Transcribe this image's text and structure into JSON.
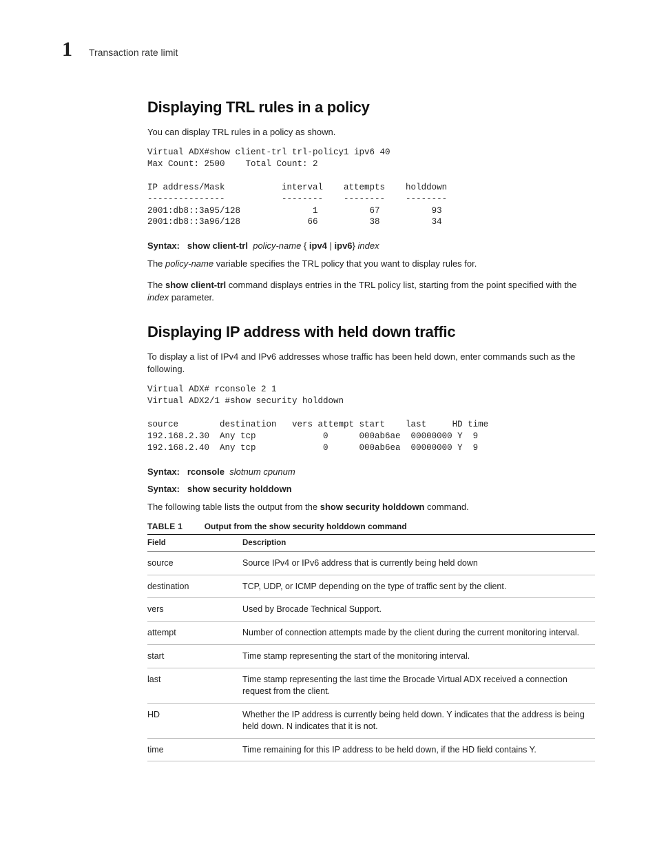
{
  "header": {
    "chapter_num": "1",
    "chapter_title": "Transaction rate limit"
  },
  "section1": {
    "title": "Displaying TRL rules in a policy",
    "intro": "You can display TRL rules in a policy as shown.",
    "code": "Virtual ADX#show client-trl trl-policy1 ipv6 40\nMax Count: 2500    Total Count: 2\n\nIP address/Mask           interval    attempts    holddown\n---------------           --------    --------    --------\n2001:db8::3a95/128              1          67          93\n2001:db8::3a96/128             66          38          34",
    "syntax_label": "Syntax:",
    "syntax_cmd": "show client-trl",
    "syntax_arg1": "policy-name",
    "syntax_brace_open": " { ",
    "syntax_opt1": "ipv4",
    "syntax_pipe": " | ",
    "syntax_opt2": "ipv6",
    "syntax_brace_close": "} ",
    "syntax_arg2": "index",
    "p1_a": "The ",
    "p1_b": "policy-name",
    "p1_c": " variable specifies the TRL policy that you want to display rules for.",
    "p2_a": "The ",
    "p2_b": "show client-trl",
    "p2_c": " command displays entries in the TRL policy list, starting from the point specified with the ",
    "p2_d": "index",
    "p2_e": " parameter."
  },
  "section2": {
    "title": "Displaying IP address with held down traffic",
    "intro": "To display a list of IPv4 and IPv6 addresses whose traffic has been held down, enter commands such as the following.",
    "code": "Virtual ADX# rconsole 2 1\nVirtual ADX2/1 #show security holddown\n\nsource        destination   vers attempt start    last     HD time\n192.168.2.30  Any tcp             0      000ab6ae  00000000 Y  9\n192.168.2.40  Any tcp             0      000ab6ea  00000000 Y  9",
    "syntax1_label": "Syntax:",
    "syntax1_cmd": "rconsole",
    "syntax1_args": "slotnum cpunum",
    "syntax2_label": "Syntax:",
    "syntax2_cmd": "show security holddown",
    "p1_a": "The following table lists the output from the ",
    "p1_b": "show security holddown",
    "p1_c": " command.",
    "table_label": "TABLE 1",
    "table_title": "Output from the show security holddown command",
    "th1": "Field",
    "th2": "Description",
    "rows": [
      {
        "field": "source",
        "desc_a": "Source IPv4 or IPv6 address that is currently being held down",
        "desc_b": "",
        "desc_c": ""
      },
      {
        "field": "destination",
        "desc_a": "TCP, UDP, or ICMP depending on the type of traffic sent by the client.",
        "desc_b": "",
        "desc_c": ""
      },
      {
        "field": "vers",
        "desc_a": "Used by Brocade Technical Support.",
        "desc_b": "",
        "desc_c": ""
      },
      {
        "field": "attempt",
        "desc_a": "Number of connection attempts made by the client during the current monitoring interval.",
        "desc_b": "",
        "desc_c": ""
      },
      {
        "field": "start",
        "desc_a": "Time stamp representing the start of the monitoring interval.",
        "desc_b": "",
        "desc_c": ""
      },
      {
        "field": "last",
        "desc_a": "Time stamp representing the last time the ",
        "desc_b": "Brocade Virtual ADX",
        "desc_c": " received a connection request from the client."
      },
      {
        "field": "HD",
        "desc_a": "Whether the IP address is currently being held down. Y indicates that the address is being held down. N indicates that it is not.",
        "desc_b": "",
        "desc_c": ""
      },
      {
        "field": "time",
        "desc_a": "Time remaining for this IP address to be held down, if the HD field contains Y.",
        "desc_b": "",
        "desc_c": ""
      }
    ]
  }
}
